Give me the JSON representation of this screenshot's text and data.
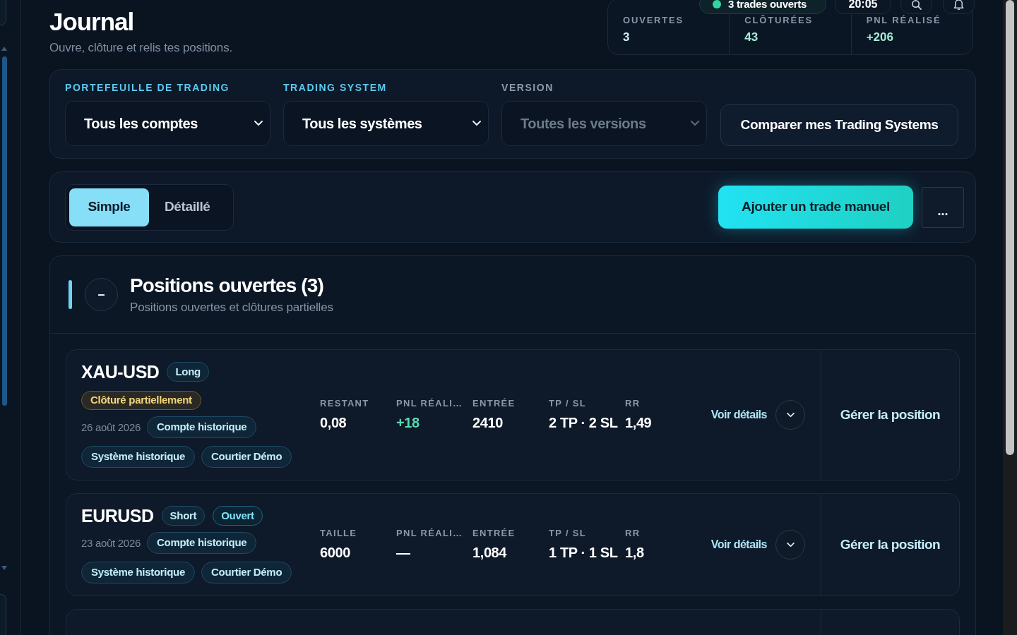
{
  "header": {
    "title": "Journal",
    "subtitle": "Ouvre, clôture et relis tes positions."
  },
  "top_bar": {
    "status": "3 trades ouverts",
    "time": "20:05"
  },
  "stats": [
    {
      "label": "OUVERTES",
      "value": "3",
      "color": "#d2ebff"
    },
    {
      "label": "CLÔTURÉES",
      "value": "43",
      "color": "#a6ecd6"
    },
    {
      "label": "PNL RÉALISÉ",
      "value": "+206",
      "color": "#a6ecd6"
    }
  ],
  "filters": {
    "fields": [
      {
        "label": "PORTEFEUILLE DE TRADING",
        "value": "Tous les comptes",
        "disabled": false
      },
      {
        "label": "TRADING SYSTEM",
        "value": "Tous les systèmes",
        "disabled": false
      },
      {
        "label": "VERSION",
        "value": "Toutes les versions",
        "disabled": true
      }
    ],
    "compare_button": "Comparer mes Trading Systems"
  },
  "toolbar": {
    "view_toggle": [
      {
        "label": "Simple",
        "selected": true
      },
      {
        "label": "Détaillé",
        "selected": false
      }
    ],
    "add_button": "Ajouter un trade manuel",
    "more_button": "..."
  },
  "positions": {
    "collapse_button": "–",
    "title": "Positions ouvertes (3)",
    "subtitle": "Positions ouvertes et clôtures partielles",
    "cards": [
      {
        "kind": "full",
        "symbol": "XAU-USD",
        "badges": [
          {
            "label": "Long",
            "kind": "side"
          }
        ],
        "status": "Clôturé partiellement",
        "date": "26 août 2026",
        "tags": [
          "Compte historique",
          "Système historique",
          "Courtier Démo"
        ],
        "metrics": [
          {
            "label": "RESTANT",
            "value": "0,08",
            "color": "#ffffff"
          },
          {
            "label": "PNL RÉALI…",
            "value": "+18",
            "color": "#56dcae"
          },
          {
            "label": "ENTRÉE",
            "value": "2410",
            "color": "#ffffff"
          },
          {
            "label": "TP / SL",
            "value": "2 TP · 2 SL",
            "color": "#ffffff"
          },
          {
            "label": "RR",
            "value": "1,49",
            "color": "#ffffff"
          }
        ],
        "details_link": "Voir détails",
        "manage_button": "Gérer la position"
      },
      {
        "kind": "full",
        "symbol": "EURUSD",
        "badges": [
          {
            "label": "Short",
            "kind": "side"
          },
          {
            "label": "Ouvert",
            "kind": "open"
          }
        ],
        "date": "23 août 2026",
        "tags": [
          "Compte historique",
          "Système historique",
          "Courtier Démo"
        ],
        "metrics": [
          {
            "label": "TAILLE",
            "value": "6000",
            "color": "#ffffff"
          },
          {
            "label": "PNL RÉALI…",
            "value": "—",
            "color": "#ffffff"
          },
          {
            "label": "ENTRÉE",
            "value": "1,084",
            "color": "#ffffff"
          },
          {
            "label": "TP / SL",
            "value": "1 TP · 1 SL",
            "color": "#ffffff"
          },
          {
            "label": "RR",
            "value": "1,8",
            "color": "#ffffff"
          }
        ],
        "details_link": "Voir détails",
        "manage_button": "Gérer la position"
      },
      {
        "kind": "cut_off"
      }
    ]
  }
}
